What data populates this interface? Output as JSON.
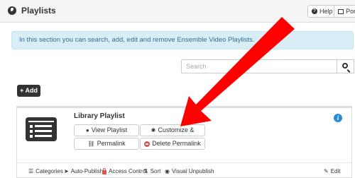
{
  "header": {
    "title": "Playlists",
    "help_label": "Help",
    "portal_label": "Portal"
  },
  "alert": {
    "text": "In this section you can search, add, edit and remove Ensemble Video Playlists."
  },
  "search": {
    "placeholder": "Search"
  },
  "toolbar": {
    "add_label": "Add"
  },
  "playlist": {
    "title": "Library Playlist",
    "actions": {
      "view": "View Playlist",
      "customize": "Customize & Embed",
      "permalink": "Permalink",
      "delete_permalink": "Delete Permalink"
    },
    "footer": {
      "categories": "Categories",
      "auto_publish": "Auto-Publish",
      "access_control": "Access Control",
      "sort": "Sort",
      "visual_unpublish": "Visual Unpublish",
      "edit": "Edit"
    }
  },
  "annotation": {
    "arrow_color": "#ff0000"
  },
  "colors": {
    "alert_bg": "#d9edf7",
    "alert_text": "#31708f",
    "info_icon": "#2a8dd4",
    "danger": "#d9534f"
  }
}
